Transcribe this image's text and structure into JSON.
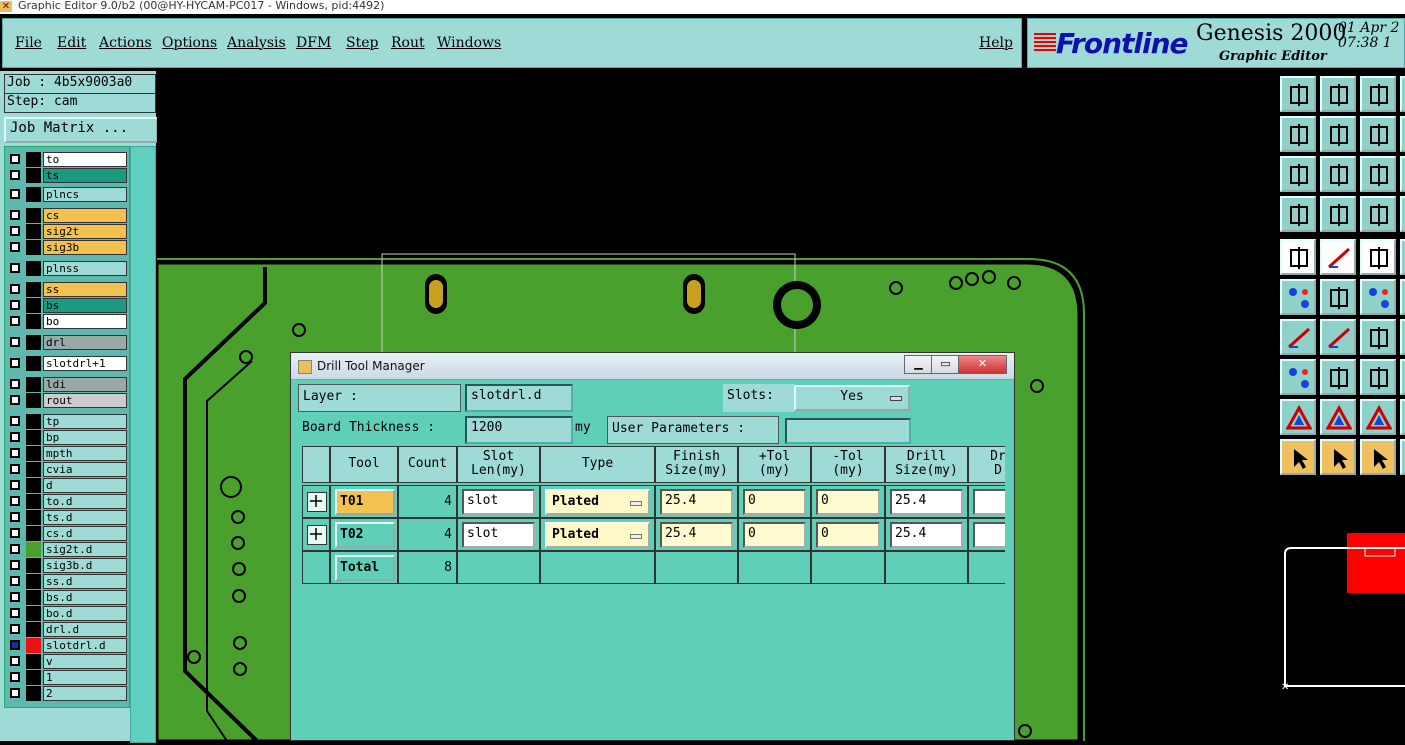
{
  "window": {
    "title": "Graphic Editor 9.0/b2 (00@HY-HYCAM-PC017 - Windows, pid:4492)"
  },
  "menu": {
    "items": [
      "File",
      "Edit",
      "Actions",
      "Options",
      "Analysis",
      "DFM",
      "Step",
      "Rout",
      "Windows"
    ],
    "help": "Help"
  },
  "brand": {
    "logo": "Frontline",
    "product": "Genesis 2000",
    "subtitle": "Graphic Editor",
    "date": "01 Apr 2",
    "time": "07:38 1"
  },
  "job": {
    "job_label": "Job : 4b5x9003a0",
    "step_label": "Step: cam",
    "job_matrix_button": "Job Matrix ..."
  },
  "layers": [
    {
      "name": "to",
      "bg": "#ffffff",
      "swatch": "#000000"
    },
    {
      "name": "ts",
      "bg": "#1a9a80",
      "swatch": "#000000"
    },
    {
      "name": "plncs",
      "bg": "#9edbd6",
      "swatch": "#000000"
    },
    {
      "name": "cs",
      "bg": "#f3c14f",
      "swatch": "#000000"
    },
    {
      "name": "sig2t",
      "bg": "#f3c14f",
      "swatch": "#000000"
    },
    {
      "name": "sig3b",
      "bg": "#f3c14f",
      "swatch": "#000000"
    },
    {
      "name": "plnss",
      "bg": "#9edbd6",
      "swatch": "#000000"
    },
    {
      "name": "ss",
      "bg": "#f3c14f",
      "swatch": "#000000"
    },
    {
      "name": "bs",
      "bg": "#1a9a80",
      "swatch": "#000000"
    },
    {
      "name": "bo",
      "bg": "#ffffff",
      "swatch": "#000000"
    },
    {
      "name": "drl",
      "bg": "#9aa8a8",
      "swatch": "#000000"
    },
    {
      "name": "slotdrl+1",
      "bg": "#ffffff",
      "swatch": "#000000"
    },
    {
      "name": "ldi",
      "bg": "#9aa8a8",
      "swatch": "#000000"
    },
    {
      "name": "rout",
      "bg": "#cccccc",
      "swatch": "#000000"
    },
    {
      "name": "tp",
      "bg": "#9edbd6",
      "swatch": "#000000"
    },
    {
      "name": "bp",
      "bg": "#9edbd6",
      "swatch": "#000000"
    },
    {
      "name": "mpth",
      "bg": "#9edbd6",
      "swatch": "#000000"
    },
    {
      "name": "cvia",
      "bg": "#9edbd6",
      "swatch": "#000000"
    },
    {
      "name": "d",
      "bg": "#9edbd6",
      "swatch": "#000000"
    },
    {
      "name": "to.d",
      "bg": "#9edbd6",
      "swatch": "#000000"
    },
    {
      "name": "ts.d",
      "bg": "#9edbd6",
      "swatch": "#000000"
    },
    {
      "name": "cs.d",
      "bg": "#9edbd6",
      "swatch": "#000000"
    },
    {
      "name": "sig2t.d",
      "bg": "#9edbd6",
      "swatch": "#4aa02c"
    },
    {
      "name": "sig3b.d",
      "bg": "#9edbd6",
      "swatch": "#000000"
    },
    {
      "name": "ss.d",
      "bg": "#9edbd6",
      "swatch": "#000000"
    },
    {
      "name": "bs.d",
      "bg": "#9edbd6",
      "swatch": "#000000"
    },
    {
      "name": "bo.d",
      "bg": "#9edbd6",
      "swatch": "#000000"
    },
    {
      "name": "drl.d",
      "bg": "#9edbd6",
      "swatch": "#000000"
    },
    {
      "name": "slotdrl.d",
      "bg": "#9edbd6",
      "swatch": "#ee1111"
    },
    {
      "name": "v",
      "bg": "#9edbd6",
      "swatch": "#000000"
    },
    {
      "name": "1",
      "bg": "#9edbd6",
      "swatch": "#000000"
    },
    {
      "name": "2",
      "bg": "#9edbd6",
      "swatch": "#000000"
    }
  ],
  "dialog": {
    "title": "Drill Tool Manager",
    "layer_label": "Layer          :",
    "layer_value": "slotdrl.d",
    "slots_label": "Slots:",
    "slots_value": "Yes",
    "board_thickness_label": "Board Thickness :",
    "board_thickness_value": "1200",
    "board_thickness_unit": "my",
    "user_params_label": "User Parameters :",
    "user_params_value": "",
    "columns": [
      "Tool",
      "Count",
      "Slot\nLen(my)",
      "Type",
      "Finish\nSize(my)",
      "+Tol\n(my)",
      "-Tol\n(my)",
      "Drill\nSize(my)",
      "Dr\nD"
    ],
    "rows": [
      {
        "tool": "T01",
        "count": "4",
        "slot_len": "slot",
        "type": "Plated",
        "finish": "25.4",
        "ptol": "0",
        "mtol": "0",
        "drill": "25.4",
        "dr": ""
      },
      {
        "tool": "T02",
        "count": "4",
        "slot_len": "slot",
        "type": "Plated",
        "finish": "25.4",
        "ptol": "0",
        "mtol": "0",
        "drill": "25.4",
        "dr": ""
      }
    ],
    "total_label": "Total",
    "total_count": "8"
  },
  "colors": {
    "panel": "#9edbd6",
    "dialog": "#5fcfb8",
    "board": "#4aa02c",
    "selected": "#f3c14f",
    "editable": "#fffbd0"
  }
}
